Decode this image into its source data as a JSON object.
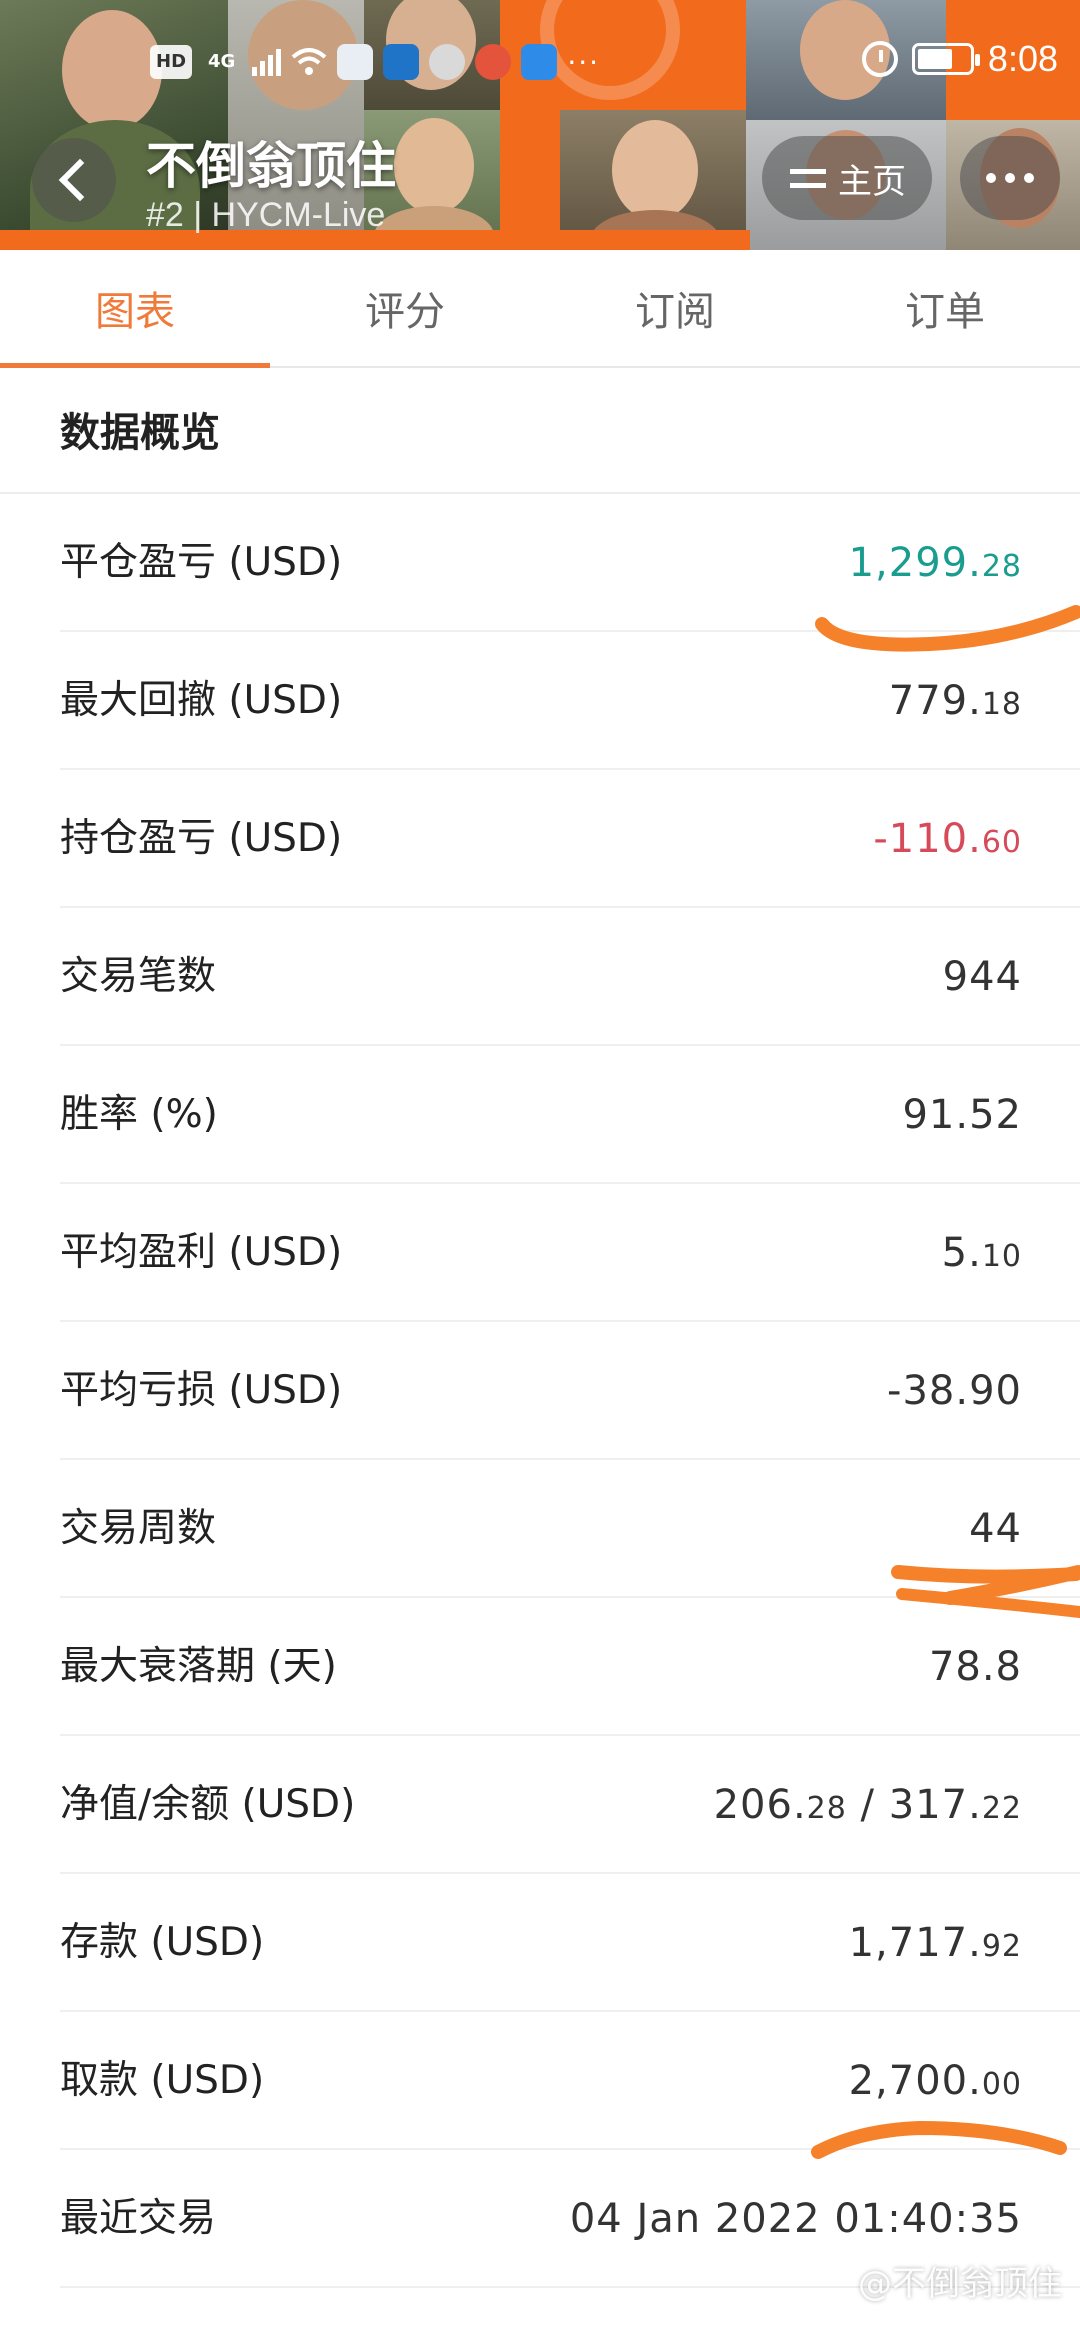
{
  "status_bar": {
    "hd": "HD",
    "network": "4G",
    "time": "8:08"
  },
  "header": {
    "title": "不倒翁顶住",
    "subtitle": "#2 | HYCM-Live",
    "home_label": "主页"
  },
  "tabs": [
    {
      "label": "图表",
      "active": true
    },
    {
      "label": "评分",
      "active": false
    },
    {
      "label": "订阅",
      "active": false
    },
    {
      "label": "订单",
      "active": false
    }
  ],
  "section_title": "数据概览",
  "rows": [
    {
      "label": "平仓盈亏 (USD)",
      "value_main": "1,299.",
      "value_small": "28",
      "tone": "positive"
    },
    {
      "label": "最大回撤 (USD)",
      "value_main": "779.",
      "value_small": "18",
      "tone": "normal"
    },
    {
      "label": "持仓盈亏 (USD)",
      "value_main": "-110.",
      "value_small": "60",
      "tone": "negative"
    },
    {
      "label": "交易笔数",
      "value_main": "944",
      "value_small": "",
      "tone": "normal"
    },
    {
      "label": "胜率 (%)",
      "value_main": "91.52",
      "value_small": "",
      "tone": "normal"
    },
    {
      "label": "平均盈利 (USD)",
      "value_main": "5.",
      "value_small": "10",
      "tone": "normal"
    },
    {
      "label": "平均亏损 (USD)",
      "value_main": "-38.90",
      "value_small": "",
      "tone": "normal"
    },
    {
      "label": "交易周数",
      "value_main": "44",
      "value_small": "",
      "tone": "normal"
    },
    {
      "label": "最大衰落期 (天)",
      "value_main": "78.8",
      "value_small": "",
      "tone": "normal"
    },
    {
      "label": "净值/余额 (USD)",
      "value_main": "206.",
      "value_small": "28",
      "value_tail": " / 317.",
      "value_small2": "22",
      "tone": "normal"
    },
    {
      "label": "存款 (USD)",
      "value_main": "1,717.",
      "value_small": "92",
      "tone": "normal"
    },
    {
      "label": "取款 (USD)",
      "value_main": "2,700.",
      "value_small": "00",
      "tone": "normal"
    },
    {
      "label": "最近交易",
      "value_main": "04 Jan 2022 01:40:35",
      "value_small": "",
      "tone": "normal"
    }
  ],
  "watermark": "@不倒翁顶住",
  "colors": {
    "accent": "#f07a3a",
    "positive": "#1a9d8f",
    "negative": "#d64b5a",
    "markup": "#f5822a"
  }
}
